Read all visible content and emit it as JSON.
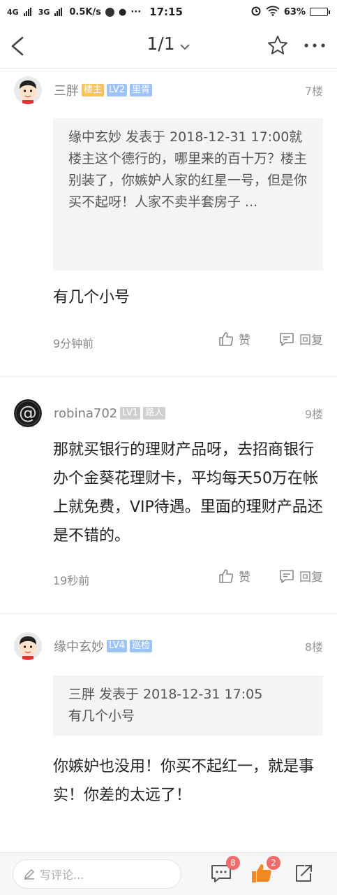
{
  "status_bar": {
    "network1": "4G",
    "network2": "3G",
    "speed": "0.5K/s",
    "time": "17:15",
    "battery_percent": "63%",
    "battery_level": 0.63
  },
  "nav": {
    "page_indicator": "1/1"
  },
  "posts": [
    {
      "username": "三胖",
      "badges": [
        "楼主",
        "LV2",
        "里胥"
      ],
      "floor": "7楼",
      "quote": "缘中玄妙 发表于 2018-12-31 17:00就楼主这个德行的，哪里来的百十万？楼主别装了，你嫉妒人家的红星一号，但是你买不起呀！人家不卖半套房子 ...",
      "text": "有几个小号",
      "time": "9分钟前",
      "like_label": "赞",
      "reply_label": "回复"
    },
    {
      "username": "robina702",
      "badges": [
        "LV1",
        "路人"
      ],
      "floor": "9楼",
      "text": "那就买银行的理财产品呀，去招商银行办个金葵花理财卡，平均每天50万在帐上就免费，VIP待遇。里面的理财产品还是不错的。",
      "time": "19秒前",
      "like_label": "赞",
      "reply_label": "回复"
    },
    {
      "username": "缘中玄妙",
      "badges": [
        "LV4",
        "巡检"
      ],
      "floor": "8楼",
      "quote": "三胖 发表于 2018-12-31 17:05\n有几个小号",
      "text": "你嫉妒也没用！你买不起红一，就是事实！你差的太远了！"
    }
  ],
  "bottom_bar": {
    "comment_placeholder": "写评论...",
    "comments_count": "8",
    "likes_count": "2"
  },
  "colors": {
    "accent_orange": "#f08a24",
    "badge_owner": "#f8c35e",
    "badge_level": "#9ec4f7",
    "badge_red": "#f26b6b"
  }
}
